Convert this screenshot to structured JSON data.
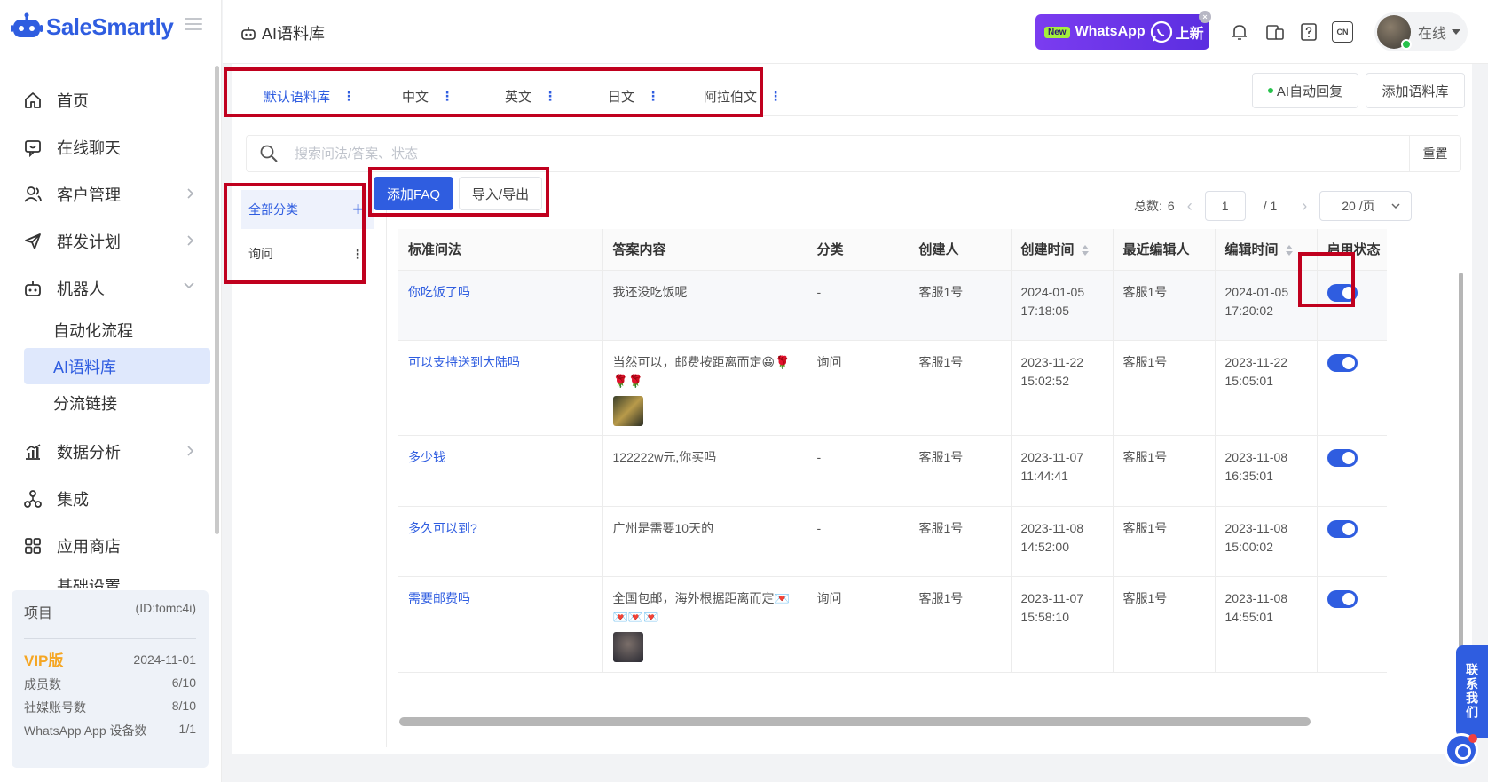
{
  "app": {
    "brand": "SaleSmartly",
    "page_title": "AI语料库"
  },
  "colors": {
    "accent": "#2f5de0",
    "highlight_box": "#c0001e",
    "vip": "#f5a623"
  },
  "sidebar": {
    "items": [
      {
        "label": "首页",
        "icon": "home-icon"
      },
      {
        "label": "在线聊天",
        "icon": "chat-icon"
      },
      {
        "label": "客户管理",
        "icon": "users-icon"
      },
      {
        "label": "群发计划",
        "icon": "send-icon"
      },
      {
        "label": "机器人",
        "icon": "robot-icon"
      },
      {
        "label": "数据分析",
        "icon": "chart-icon"
      },
      {
        "label": "集成",
        "icon": "integration-icon"
      },
      {
        "label": "应用商店",
        "icon": "apps-icon"
      }
    ],
    "sub_items": [
      "自动化流程",
      "AI语料库",
      "分流链接"
    ],
    "cut_item": "基础设置"
  },
  "project": {
    "title": "项目",
    "id": "(ID:fomc4i)",
    "plan": "VIP版",
    "expiry": "2024-11-01",
    "rows": [
      {
        "label": "成员数",
        "value": "6/10"
      },
      {
        "label": "社媒账号数",
        "value": "8/10"
      },
      {
        "label": "WhatsApp App 设备数",
        "value": "1/1"
      }
    ]
  },
  "header": {
    "banner_new": "New",
    "banner_text": "WhatsApp",
    "banner_suffix": "上新",
    "banner_close": "×",
    "lang_badge": "CN",
    "status": "在线"
  },
  "tabs": [
    {
      "label": "默认语料库",
      "active": true
    },
    {
      "label": "中文"
    },
    {
      "label": "英文"
    },
    {
      "label": "日文"
    },
    {
      "label": "阿拉伯文"
    }
  ],
  "tab_more": "⋮",
  "toolbar": {
    "ai_reply": "AI自动回复",
    "add_library": "添加语料库",
    "add_faq": "添加FAQ",
    "import_export": "导入/导出"
  },
  "search": {
    "placeholder": "搜索问法/答案、状态",
    "reset": "重置"
  },
  "categories": {
    "all": "全部分类",
    "add": "+",
    "items": [
      "询问"
    ]
  },
  "pagination": {
    "total_label": "总数:",
    "total": "6",
    "current": "1",
    "pages": "/  1",
    "page_size": "20 /页"
  },
  "table": {
    "columns": [
      "标准问法",
      "答案内容",
      "分类",
      "创建人",
      "创建时间",
      "最近编辑人",
      "编辑时间",
      "启用状态"
    ],
    "rows": [
      {
        "question": "你吃饭了吗",
        "answer": "我还没吃饭呢",
        "category": "-",
        "creator": "客服1号",
        "created": "2024-01-05 17:18:05",
        "editor": "客服1号",
        "edited": "2024-01-05 17:20:02",
        "enabled": true
      },
      {
        "question": "可以支持送到大陆吗",
        "answer": "当然可以，邮费按距离而定😀🌹🌹🌹",
        "category": "询问",
        "creator": "客服1号",
        "created": "2023-11-22 15:02:52",
        "editor": "客服1号",
        "edited": "2023-11-22 15:05:01",
        "enabled": true
      },
      {
        "question": "多少钱",
        "answer": "122222w元,你买吗",
        "category": "-",
        "creator": "客服1号",
        "created": "2023-11-07 11:44:41",
        "editor": "客服1号",
        "edited": "2023-11-08 16:35:01",
        "enabled": true
      },
      {
        "question": "多久可以到?",
        "answer": "广州是需要10天的",
        "category": "-",
        "creator": "客服1号",
        "created": "2023-11-08 14:52:00",
        "editor": "客服1号",
        "edited": "2023-11-08 15:00:02",
        "enabled": true
      },
      {
        "question": "需要邮费吗",
        "answer": "全国包邮，海外根据距离而定💌💌💌💌",
        "category": "询问",
        "creator": "客服1号",
        "created": "2023-11-07 15:58:10",
        "editor": "客服1号",
        "edited": "2023-11-08 14:55:01",
        "enabled": true
      }
    ]
  },
  "contact": "联系我们"
}
